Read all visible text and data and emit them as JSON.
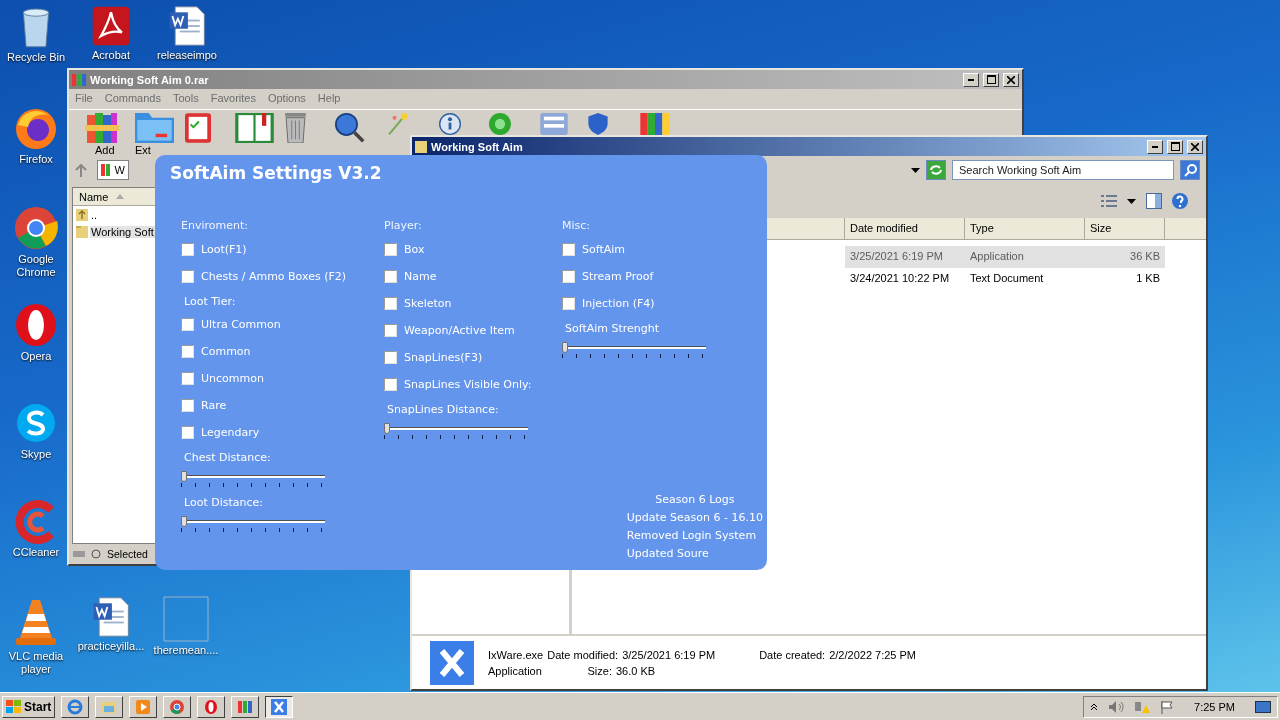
{
  "desktop_icons": [
    {
      "label": "Recycle Bin",
      "kind": "bin"
    },
    {
      "label": "Acrobat",
      "kind": "pdf"
    },
    {
      "label": "releaseimpo",
      "kind": "word"
    },
    {
      "label": "Firefox",
      "kind": "firefox"
    },
    {
      "label": "Google Chrome",
      "kind": "chrome"
    },
    {
      "label": "Opera",
      "kind": "opera"
    },
    {
      "label": "Skype",
      "kind": "skype"
    },
    {
      "label": "CCleaner",
      "kind": "ccleaner"
    },
    {
      "label": "VLC media player",
      "kind": "vlc"
    },
    {
      "label": "practiceyilla...",
      "kind": "word"
    },
    {
      "label": "theremean....",
      "kind": "blank"
    }
  ],
  "archive_window": {
    "title": "Working Soft Aim 0.rar",
    "active": false,
    "menu": [
      "File",
      "Commands",
      "Tools",
      "Favorites",
      "Options",
      "Help"
    ],
    "toolbar": [
      {
        "kind": "add",
        "label": "Add"
      },
      {
        "kind": "extract",
        "label": "Ext"
      },
      {
        "kind": "test"
      },
      {
        "kind": "view"
      },
      {
        "kind": "delete"
      },
      {
        "kind": "find"
      },
      {
        "kind": "wizard"
      },
      {
        "kind": "info"
      },
      {
        "kind": "scan"
      },
      {
        "kind": "comment"
      },
      {
        "kind": "protect"
      },
      {
        "kind": "sfx"
      }
    ],
    "path": "W",
    "list_header": "Name",
    "rows": [
      {
        "name": "..",
        "kind": "up",
        "selected": false
      },
      {
        "name": "Working Soft",
        "kind": "folder",
        "selected": true
      }
    ],
    "status": "Selected"
  },
  "explorer_window": {
    "title": "Working Soft Aim",
    "active": true,
    "search": {
      "placeholder": "Search Working Soft Aim"
    },
    "columns": [
      "Date modified",
      "Type",
      "Size"
    ],
    "rows": [
      {
        "date": "3/25/2021 6:19 PM",
        "type": "Application",
        "size": "36 KB",
        "selected": true
      },
      {
        "date": "3/24/2021 10:22 PM",
        "type": "Text Document",
        "size": "1 KB",
        "selected": false
      }
    ],
    "details": {
      "name": "IxWare.exe",
      "type": "Application",
      "modified_label": "Date modified:",
      "modified": "3/25/2021 6:19 PM",
      "size_label": "Size:",
      "size": "36.0 KB",
      "created_label": "Date created:",
      "created": "2/2/2022 7:25 PM"
    }
  },
  "settings_panel": {
    "title": "SoftAim Settings V3.2",
    "columns": [
      {
        "heading": "Enviroment:",
        "items": [
          {
            "kind": "checkbox",
            "label": "Loot(F1)",
            "checked": false
          },
          {
            "kind": "checkbox",
            "label": "Chests / Ammo Boxes (F2)",
            "checked": false
          },
          {
            "kind": "label",
            "label": "Loot Tier:"
          },
          {
            "kind": "checkbox",
            "label": "Ultra Common",
            "checked": false
          },
          {
            "kind": "checkbox",
            "label": "Common",
            "checked": false
          },
          {
            "kind": "checkbox",
            "label": "Uncommon",
            "checked": false
          },
          {
            "kind": "checkbox",
            "label": "Rare",
            "checked": false
          },
          {
            "kind": "checkbox",
            "label": "Legendary",
            "checked": false
          },
          {
            "kind": "label",
            "label": "Chest Distance:"
          },
          {
            "kind": "slider",
            "level": 0
          },
          {
            "kind": "label",
            "label": "Loot Distance:"
          },
          {
            "kind": "slider",
            "level": 0
          }
        ]
      },
      {
        "heading": "Player:",
        "items": [
          {
            "kind": "checkbox",
            "label": "Box",
            "checked": false
          },
          {
            "kind": "checkbox",
            "label": "Name",
            "checked": false
          },
          {
            "kind": "checkbox",
            "label": "Skeleton",
            "checked": false
          },
          {
            "kind": "checkbox",
            "label": "Weapon/Active Item",
            "checked": false
          },
          {
            "kind": "checkbox",
            "label": "SnapLines(F3)",
            "checked": false
          },
          {
            "kind": "checkbox",
            "label": "SnapLines Visible Only:",
            "checked": false
          },
          {
            "kind": "label",
            "label": "SnapLines Distance:"
          },
          {
            "kind": "slider",
            "level": 0
          }
        ]
      },
      {
        "heading": "Misc:",
        "items": [
          {
            "kind": "checkbox",
            "label": "SoftAim",
            "checked": false
          },
          {
            "kind": "checkbox",
            "label": "Stream Proof",
            "checked": false
          },
          {
            "kind": "checkbox",
            "label": "Injection (F4)",
            "checked": false
          },
          {
            "kind": "label",
            "label": "SoftAim Strenght"
          },
          {
            "kind": "slider",
            "level": 0
          }
        ]
      }
    ],
    "logs": [
      "Season 6 Logs",
      "Update Season 6 - 16.10",
      "Removed Login System",
      "Updated Soure"
    ]
  },
  "taskbar": {
    "start": "Start",
    "apps": [
      {
        "kind": "ie",
        "active": false
      },
      {
        "kind": "explorer",
        "active": false
      },
      {
        "kind": "media",
        "active": false
      },
      {
        "kind": "chrome",
        "active": false
      },
      {
        "kind": "opera",
        "active": false
      },
      {
        "kind": "winrar",
        "active": false
      },
      {
        "kind": "ixware",
        "active": true
      }
    ],
    "clock": "7:25 PM"
  }
}
